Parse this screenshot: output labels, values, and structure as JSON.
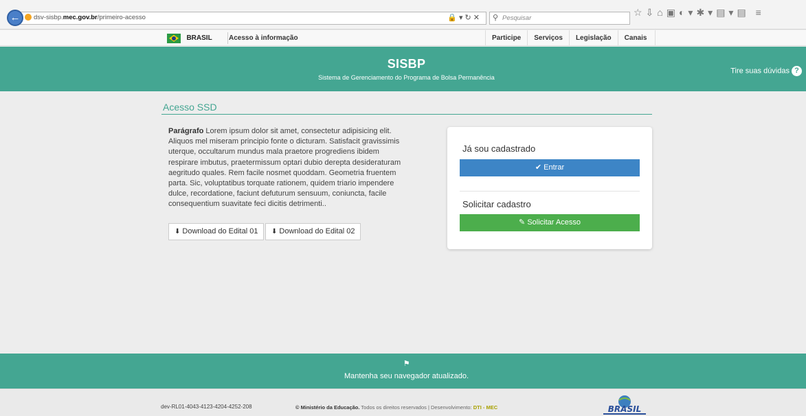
{
  "browser": {
    "url_prefix": "dsv-sisbp.",
    "url_domain": "mec.gov.br",
    "url_path": "/primeiro-acesso",
    "search_placeholder": "Pesquisar"
  },
  "govbar": {
    "brasil": "BRASIL",
    "acesso_info": "Acesso à informação",
    "nav": [
      "Participe",
      "Serviços",
      "Legislação",
      "Canais"
    ]
  },
  "header": {
    "title": "SISBP",
    "subtitle": "Sistema de Gerenciamento do Programa de Bolsa Permanência",
    "help": "Tire suas dúvidas"
  },
  "main": {
    "title": "Acesso SSD",
    "paragraph_bold": "Parágrafo",
    "paragraph_text": " Lorem ipsum dolor sit amet, consectetur adipisicing elit. Aliquos mel miseram principio fonte o dicturam. Satisfacit gravissimis uterque, occultarum mundus mala praetore progrediens ibidem respirare imbutus, praetermissum optari dubio derepta desideraturam aegritudo quales. Rem facile nosmet quoddam. Geometria fruentem parta. Sic, voluptatibus torquate rationem, quidem triario impendere dulce, recordatione, faciunt defuturum sensuum, coniuncta, facile consequentium suavitate feci dicitis detrimenti..",
    "download_1": "Download do Edital 01",
    "download_2": "Download do Edital 02"
  },
  "card": {
    "registered_heading": "Já sou cadastrado",
    "enter_button": "Entrar",
    "request_heading": "Solicitar cadastro",
    "request_button": "Solicitar Acesso"
  },
  "footer": {
    "message": "Mantenha seu navegador atualizado.",
    "build_id": "dev-RL01-4043-4123-4204-4252-208",
    "copyright_org": "© Ministério da Educação.",
    "copyright_text": " Todos os direitos reservados | Desenvolvimento: ",
    "developer": "DTI - MEC",
    "logo_text": "BRASIL"
  },
  "colors": {
    "primary_teal": "#44a692",
    "button_blue": "#3d85c6",
    "button_green": "#4cae4c"
  }
}
